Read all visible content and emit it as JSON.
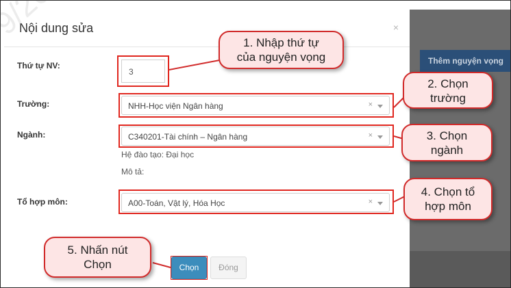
{
  "watermark": "9/2020 09:",
  "modal": {
    "title": "Nội dung sửa",
    "close_glyph": "×"
  },
  "background": {
    "add_button_label": "Thêm nguyện vọng"
  },
  "form": {
    "order_label": "Thứ tự NV:",
    "order_value": "3",
    "school_label": "Trường:",
    "school_value": "NHH-Học viện Ngân hàng",
    "major_label": "Ngành:",
    "major_value": "C340201-Tài chính – Ngân hàng",
    "training_system": "Hệ đào tạo: Đại học",
    "description": "Mô tả:",
    "subject_combo_label": "Tổ hợp môn:",
    "subject_combo_value": "A00-Toán, Vật lý, Hóa Học",
    "clear_glyph": "×"
  },
  "buttons": {
    "choose": "Chọn",
    "close": "Đóng"
  },
  "callouts": {
    "step1": [
      "1. Nhập thứ tự",
      "của nguyện vọng"
    ],
    "step2": [
      "2. Chọn",
      "trường"
    ],
    "step3": [
      "3. Chọn",
      "ngành"
    ],
    "step4": [
      "4. Chọn tổ",
      "hợp môn"
    ],
    "step5": [
      "5. Nhấn nút",
      "Chọn"
    ]
  },
  "colors": {
    "highlight_red": "#e0261e",
    "callout_fill": "#fde5e5",
    "primary_blue": "#3c8dbc",
    "backdrop": "#6b6b6b"
  }
}
